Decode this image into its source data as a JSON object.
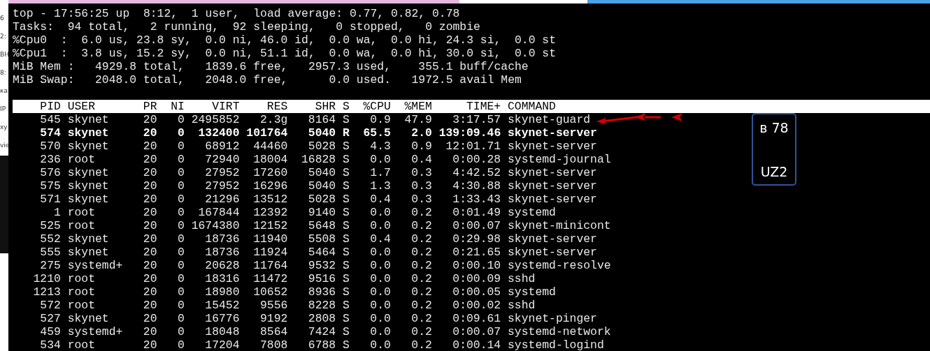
{
  "background_fragments": [
    "6",
    "2:",
    "ВН",
    "8:",
    "ка",
    "IP",
    "ху",
    "vie"
  ],
  "summary_lines": [
    "top - 17:56:25 up  8:12,  1 user,  load average: 0.77, 0.82, 0.78",
    "Tasks:  94 total,   2 running,  92 sleeping,   0 stopped,   0 zombie",
    "%Cpu0  :  6.0 us, 23.8 sy,  0.0 ni, 46.0 id,  0.0 wa,  0.0 hi, 24.3 si,  0.0 st",
    "%Cpu1  :  3.8 us, 15.2 sy,  0.0 ni, 51.1 id,  0.0 wa,  0.0 hi, 30.0 si,  0.0 st",
    "MiB Mem :   4929.8 total,   1839.6 free,   2957.3 used,    355.1 buff/cache",
    "MiB Swap:   2048.0 total,   2048.0 free,      0.0 used.   1972.5 avail Mem"
  ],
  "process_table": {
    "columns": [
      "PID",
      "USER",
      "PR",
      "NI",
      "VIRT",
      "RES",
      "SHR",
      "S",
      "%CPU",
      "%MEM",
      "TIME+",
      "COMMAND"
    ],
    "rows": [
      {
        "cells": [
          "545",
          "skynet",
          "20",
          "0",
          "2495852",
          "2.3g",
          "8164",
          "S",
          "0.9",
          "47.9",
          "3:17.57",
          "skynet-guard"
        ],
        "highlighted": false
      },
      {
        "cells": [
          "574",
          "skynet",
          "20",
          "0",
          "132400",
          "101764",
          "5040",
          "R",
          "65.5",
          "2.0",
          "139:09.46",
          "skynet-server"
        ],
        "highlighted": true
      },
      {
        "cells": [
          "570",
          "skynet",
          "20",
          "0",
          "68912",
          "44460",
          "5028",
          "S",
          "4.3",
          "0.9",
          "12:01.71",
          "skynet-server"
        ],
        "highlighted": false
      },
      {
        "cells": [
          "236",
          "root",
          "20",
          "0",
          "72940",
          "18004",
          "16828",
          "S",
          "0.0",
          "0.4",
          "0:00.28",
          "systemd-journal"
        ],
        "highlighted": false
      },
      {
        "cells": [
          "576",
          "skynet",
          "20",
          "0",
          "27952",
          "17260",
          "5040",
          "S",
          "1.7",
          "0.3",
          "4:42.52",
          "skynet-server"
        ],
        "highlighted": false
      },
      {
        "cells": [
          "575",
          "skynet",
          "20",
          "0",
          "27952",
          "16296",
          "5040",
          "S",
          "1.3",
          "0.3",
          "4:30.88",
          "skynet-server"
        ],
        "highlighted": false
      },
      {
        "cells": [
          "571",
          "skynet",
          "20",
          "0",
          "21296",
          "13512",
          "5028",
          "S",
          "0.4",
          "0.3",
          "1:33.43",
          "skynet-server"
        ],
        "highlighted": false
      },
      {
        "cells": [
          "1",
          "root",
          "20",
          "0",
          "167844",
          "12392",
          "9140",
          "S",
          "0.0",
          "0.2",
          "0:01.49",
          "systemd"
        ],
        "highlighted": false
      },
      {
        "cells": [
          "525",
          "root",
          "20",
          "0",
          "1674380",
          "12152",
          "5648",
          "S",
          "0.0",
          "0.2",
          "0:00.07",
          "skynet-minicont"
        ],
        "highlighted": false
      },
      {
        "cells": [
          "552",
          "skynet",
          "20",
          "0",
          "18736",
          "11940",
          "5508",
          "S",
          "0.4",
          "0.2",
          "0:29.98",
          "skynet-server"
        ],
        "highlighted": false
      },
      {
        "cells": [
          "555",
          "skynet",
          "20",
          "0",
          "18736",
          "11924",
          "5464",
          "S",
          "0.0",
          "0.2",
          "0:21.65",
          "skynet-server"
        ],
        "highlighted": false
      },
      {
        "cells": [
          "275",
          "systemd+",
          "20",
          "0",
          "20628",
          "11764",
          "9532",
          "S",
          "0.0",
          "0.2",
          "0:00.10",
          "systemd-resolve"
        ],
        "highlighted": false
      },
      {
        "cells": [
          "1210",
          "root",
          "20",
          "0",
          "18316",
          "11472",
          "9516",
          "S",
          "0.0",
          "0.2",
          "0:00.09",
          "sshd"
        ],
        "highlighted": false
      },
      {
        "cells": [
          "1213",
          "root",
          "20",
          "0",
          "18980",
          "10652",
          "8936",
          "S",
          "0.0",
          "0.2",
          "0:00.05",
          "systemd"
        ],
        "highlighted": false
      },
      {
        "cells": [
          "572",
          "root",
          "20",
          "0",
          "15452",
          "9556",
          "8228",
          "S",
          "0.0",
          "0.2",
          "0:00.02",
          "sshd"
        ],
        "highlighted": false
      },
      {
        "cells": [
          "527",
          "skynet",
          "20",
          "0",
          "16776",
          "9192",
          "2808",
          "S",
          "0.0",
          "0.2",
          "0:09.61",
          "skynet-pinger"
        ],
        "highlighted": false
      },
      {
        "cells": [
          "459",
          "systemd+",
          "20",
          "0",
          "18048",
          "8564",
          "7424",
          "S",
          "0.0",
          "0.2",
          "0:00.07",
          "systemd-network"
        ],
        "highlighted": false
      },
      {
        "cells": [
          "534",
          "root",
          "20",
          "0",
          "17204",
          "7808",
          "6788",
          "S",
          "0.0",
          "0.2",
          "0:00.14",
          "systemd-logind"
        ],
        "highlighted": false
      }
    ]
  },
  "note_box": {
    "lines": [
      "в 78",
      "UZ2"
    ]
  }
}
